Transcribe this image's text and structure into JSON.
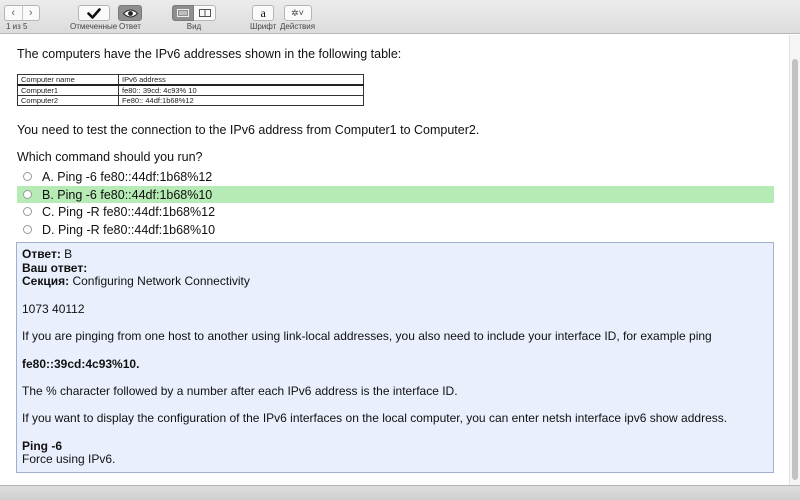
{
  "toolbar": {
    "prev_icon": "‹",
    "next_icon": "›",
    "page_counter": "1 из 5",
    "marked_label": "Отмеченные",
    "answer_label": "Ответ",
    "view_label": "Вид",
    "font_label": "Шрифт",
    "font_icon": "a",
    "actions_label": "Действия",
    "actions_icon": "✲˅"
  },
  "question": {
    "intro": "The computers have the IPv6 addresses shown in the following table:",
    "table": {
      "headers": [
        "Computer name",
        "IPv6 address"
      ],
      "rows": [
        [
          "Computer1",
          "fe80:: 39cd: 4c93% 10"
        ],
        [
          "Computer2",
          "Fe80:: 44df:1b68%12"
        ]
      ]
    },
    "task": "You need to test the connection to the IPv6 address from Computer1 to Computer2.",
    "prompt": "Which command should you run?",
    "options": [
      {
        "text": "A. Ping -6 fe80::44df:1b68%12"
      },
      {
        "text": "B. Ping -6 fe80::44df:1b68%10"
      },
      {
        "text": "C. Ping -R fe80::44df:1b68%12"
      },
      {
        "text": "D. Ping -R fe80::44df:1b68%10"
      }
    ]
  },
  "answer": {
    "answer_label": "Ответ:",
    "answer_value": " B",
    "your_answer_label": "Ваш ответ:",
    "section_label": "Секция:",
    "section_value": " Configuring Network Connectivity",
    "ref": "1073 40112",
    "para1": "If you are pinging from one host to another using link-local addresses, you also need to include your interface ID, for example ping",
    "example": "fe80::39cd:4c93%10.",
    "para2": "The % character followed by a number after each IPv6 address is the interface ID.",
    "para3": "If you want to display the configuration of the IPv6 interfaces on the local computer, you can enter netsh interface ipv6 show address.",
    "ping_heading": "Ping -6",
    "ping_desc": "Force using IPv6."
  },
  "colors": {
    "correct_highlight": "#b6ebb6",
    "answer_bg": "#e9effd"
  }
}
